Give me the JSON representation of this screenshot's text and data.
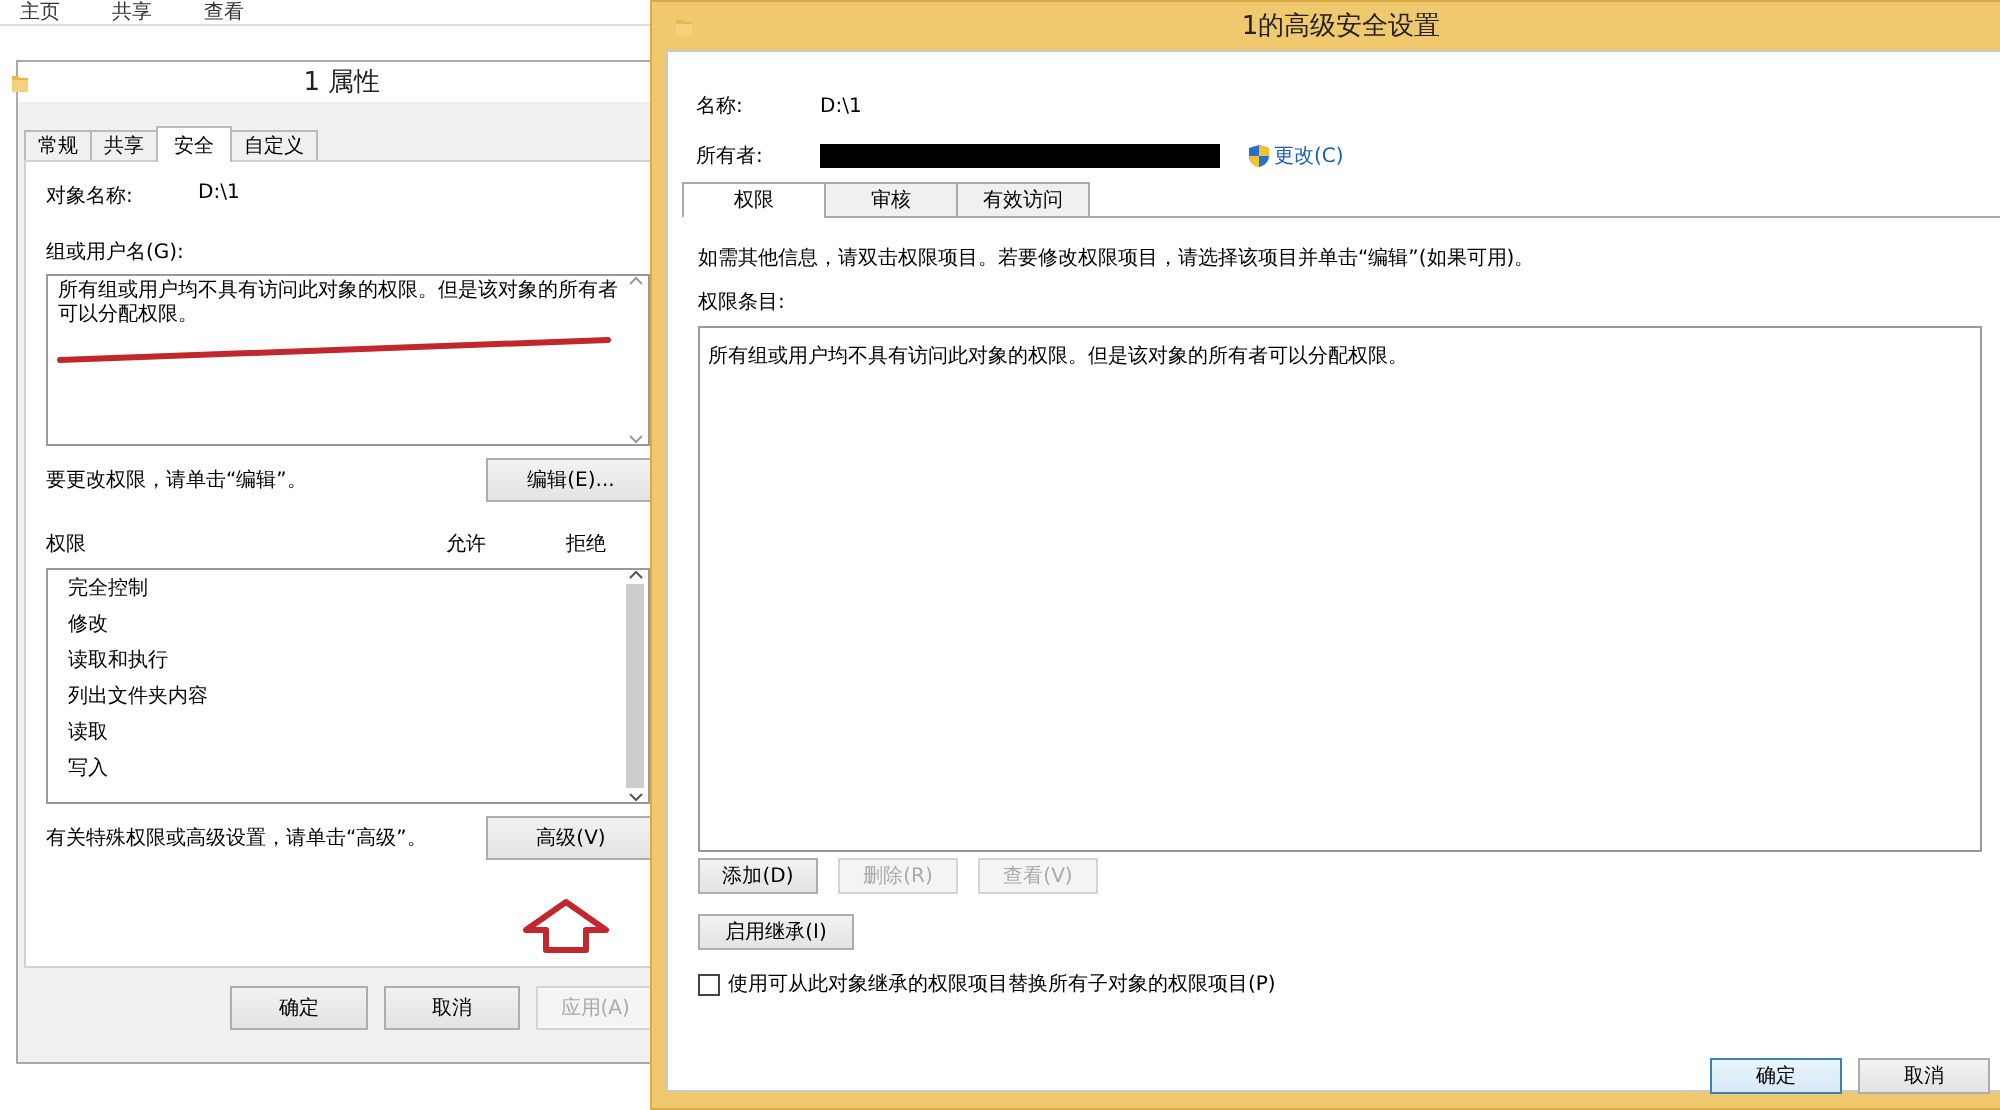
{
  "explorer": {
    "ribbon_tabs": [
      "主页",
      "共享",
      "查看"
    ]
  },
  "properties_dialog": {
    "title": "1 属性",
    "tabs": [
      {
        "label": "常规",
        "selected": false
      },
      {
        "label": "共享",
        "selected": false
      },
      {
        "label": "安全",
        "selected": true
      },
      {
        "label": "自定义",
        "selected": false
      }
    ],
    "object_name_label": "对象名称:",
    "object_name": "D:\\1",
    "groups_label": "组或用户名(G):",
    "groups_message": "所有组或用户均不具有访问此对象的权限。但是该对象的所有者可以分配权限。",
    "edit_hint": "要更改权限，请单击“编辑”。",
    "edit_button": "编辑(E)...",
    "permissions_label": "权限",
    "allow_label": "允许",
    "deny_label": "拒绝",
    "permissions": [
      "完全控制",
      "修改",
      "读取和执行",
      "列出文件夹内容",
      "读取",
      "写入"
    ],
    "advanced_hint": "有关特殊权限或高级设置，请单击“高级”。",
    "advanced_button": "高级(V)",
    "buttons": [
      {
        "label": "确定",
        "disabled": false
      },
      {
        "label": "取消",
        "disabled": false
      },
      {
        "label": "应用(A)",
        "disabled": true
      }
    ]
  },
  "advanced_dialog": {
    "title": "1的高级安全设置",
    "name_label": "名称:",
    "name": "D:\\1",
    "owner_label": "所有者:",
    "change_link": "更改(C)",
    "tabs": [
      {
        "label": "权限",
        "selected": true
      },
      {
        "label": "审核",
        "selected": false
      },
      {
        "label": "有效访问",
        "selected": false
      }
    ],
    "info": "如需其他信息，请双击权限项目。若要修改权限项目，请选择该项目并单击“编辑”(如果可用)。",
    "entries_label": "权限条目:",
    "entries_message": "所有组或用户均不具有访问此对象的权限。但是该对象的所有者可以分配权限。",
    "entry_buttons": [
      {
        "label": "添加(D)",
        "disabled": false
      },
      {
        "label": "删除(R)",
        "disabled": true
      },
      {
        "label": "查看(V)",
        "disabled": true
      }
    ],
    "inherit_button": "启用继承(I)",
    "replace_checkbox": {
      "label": "使用可从此对象继承的权限项目替换所有子对象的权限项目(P)",
      "checked": false
    },
    "buttons": [
      {
        "label": "确定",
        "default": true
      },
      {
        "label": "取消",
        "default": false
      }
    ]
  }
}
